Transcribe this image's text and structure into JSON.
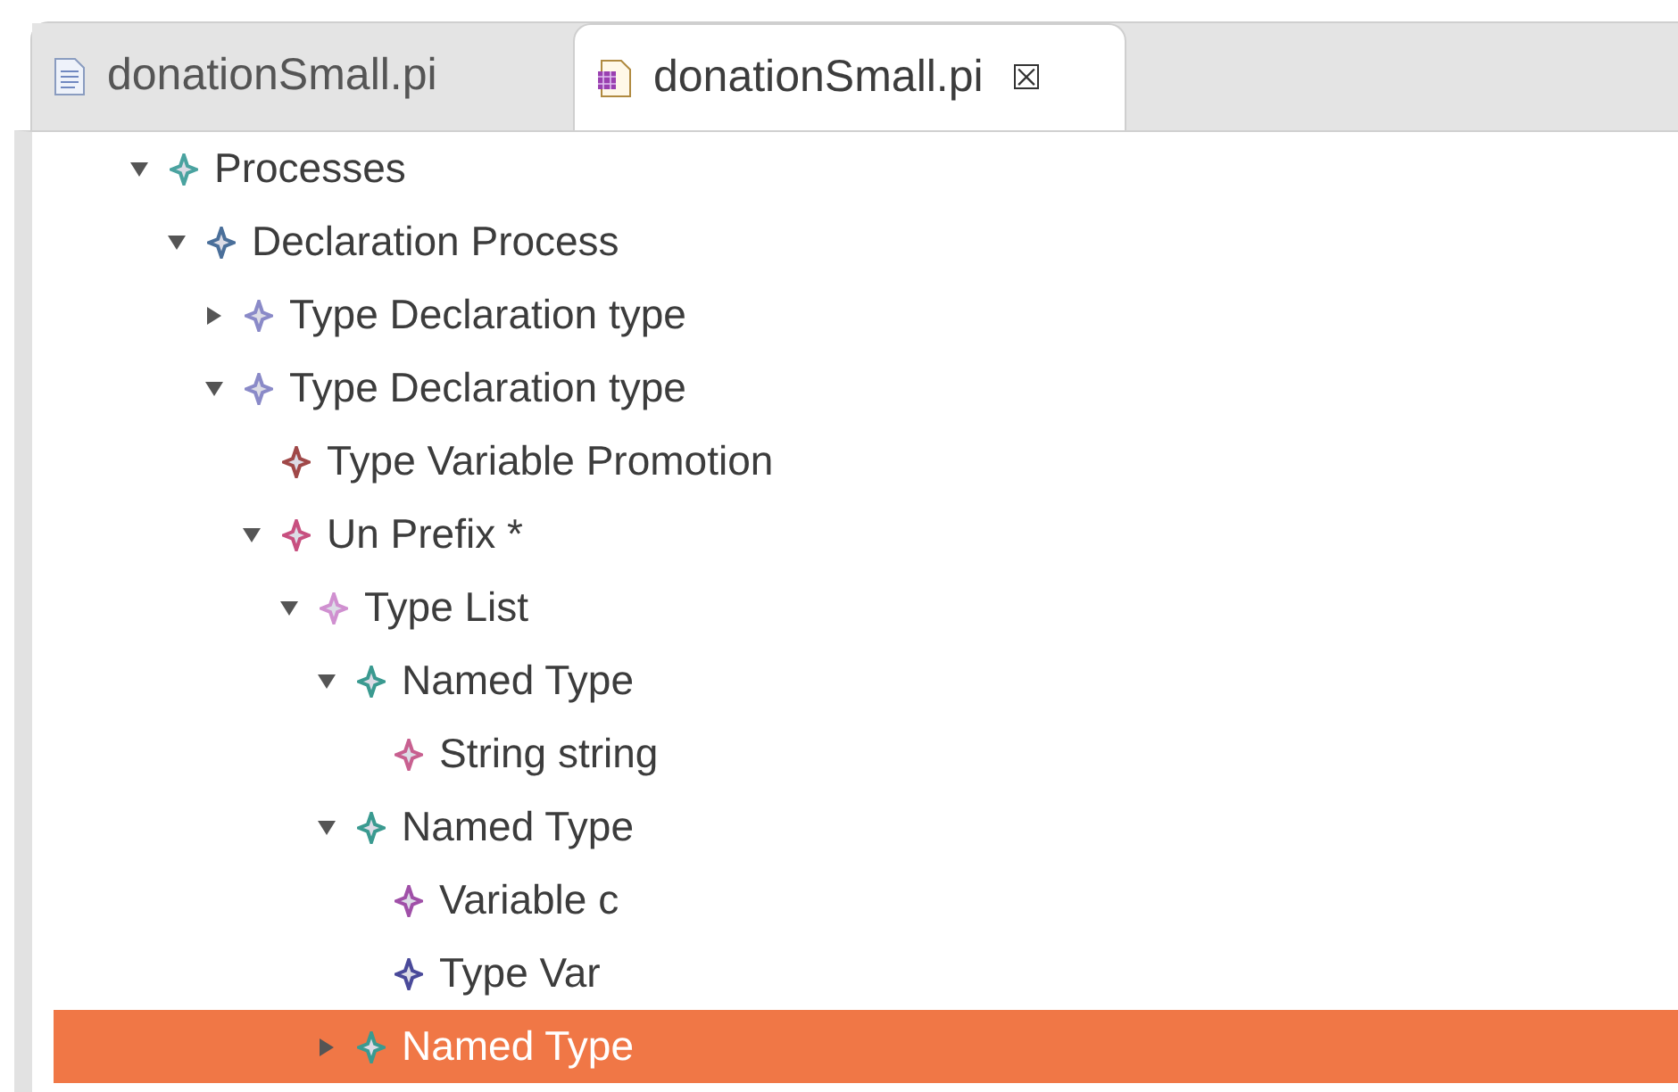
{
  "tabs": [
    {
      "label": "donationSmall.pi",
      "selected": false,
      "kind": "text-file"
    },
    {
      "label": "donationSmall.pi",
      "selected": true,
      "kind": "model-file",
      "close": "⮽"
    }
  ],
  "tree": [
    {
      "label": "Processes",
      "kind": "branch",
      "expanded": true,
      "selected": false,
      "color": "#4aa3a0",
      "children": [
        {
          "label": "Declaration Process",
          "kind": "branch",
          "expanded": true,
          "selected": false,
          "color": "#4a6f9a",
          "children": [
            {
              "label": "Type Declaration type",
              "kind": "branch",
              "expanded": false,
              "selected": false,
              "color": "#8a8ac8"
            },
            {
              "label": "Type Declaration type",
              "kind": "branch",
              "expanded": true,
              "selected": false,
              "color": "#8a8ac8",
              "children": [
                {
                  "label": "Type Variable Promotion",
                  "selected": false,
                  "color": "#a04848"
                },
                {
                  "label": "Un Prefix *",
                  "kind": "branch",
                  "expanded": true,
                  "selected": false,
                  "color": "#c85080",
                  "children": [
                    {
                      "label": "Type List",
                      "kind": "branch",
                      "expanded": true,
                      "selected": false,
                      "color": "#d090d0",
                      "children": [
                        {
                          "label": "Named Type",
                          "kind": "branch",
                          "expanded": true,
                          "selected": false,
                          "color": "#3a9a90",
                          "children": [
                            {
                              "label": "String string",
                              "selected": false,
                              "color": "#c86090"
                            }
                          ]
                        },
                        {
                          "label": "Named Type",
                          "kind": "branch",
                          "expanded": true,
                          "selected": false,
                          "color": "#3a9a90",
                          "children": [
                            {
                              "label": "Variable c",
                              "selected": false,
                              "color": "#a050a8"
                            },
                            {
                              "label": "Type Var",
                              "selected": false,
                              "color": "#4a4a9a"
                            }
                          ]
                        },
                        {
                          "label": "Named Type",
                          "kind": "branch",
                          "expanded": false,
                          "selected": true,
                          "color": "#3a9a90"
                        }
                      ]
                    }
                  ]
                }
              ]
            }
          ]
        }
      ]
    }
  ]
}
